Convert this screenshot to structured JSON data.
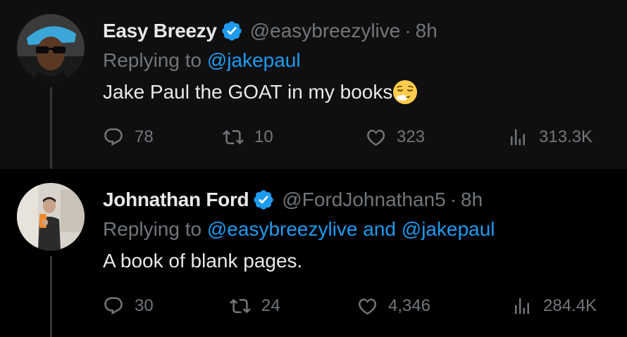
{
  "tweets": [
    {
      "author_name": "Easy Breezy",
      "verified": true,
      "handle": "@easybreezylive",
      "separator": "·",
      "time": "8h",
      "replying_prefix": "Replying to",
      "replying_to": [
        "@jakepaul"
      ],
      "replying_joiner": "",
      "text": "Jake Paul the GOAT in my books",
      "emoji": "relieved-face-emoji",
      "stats": {
        "replies": "78",
        "reposts": "10",
        "likes": "323",
        "views": "313.3K"
      }
    },
    {
      "author_name": "Johnathan Ford",
      "verified": true,
      "handle": "@FordJohnathan5",
      "separator": "·",
      "time": "8h",
      "replying_prefix": "Replying to",
      "replying_to": [
        "@easybreezylive",
        "@jakepaul"
      ],
      "replying_joiner": "and",
      "text": "A book of blank pages.",
      "stats": {
        "replies": "30",
        "reposts": "24",
        "likes": "4,346",
        "views": "284.4K"
      }
    }
  ],
  "colors": {
    "background": "#000000",
    "highlight_background": "#0f0f0f",
    "primary_text": "#e7e9ea",
    "secondary_text": "#71767b",
    "link": "#1d9bf0",
    "verified_badge": "#1d9bf0",
    "thread_line": "#333639"
  },
  "icons": {
    "reply": "reply-icon",
    "repost": "repost-icon",
    "like": "like-icon",
    "views": "views-icon",
    "verified": "verified-badge-icon"
  }
}
